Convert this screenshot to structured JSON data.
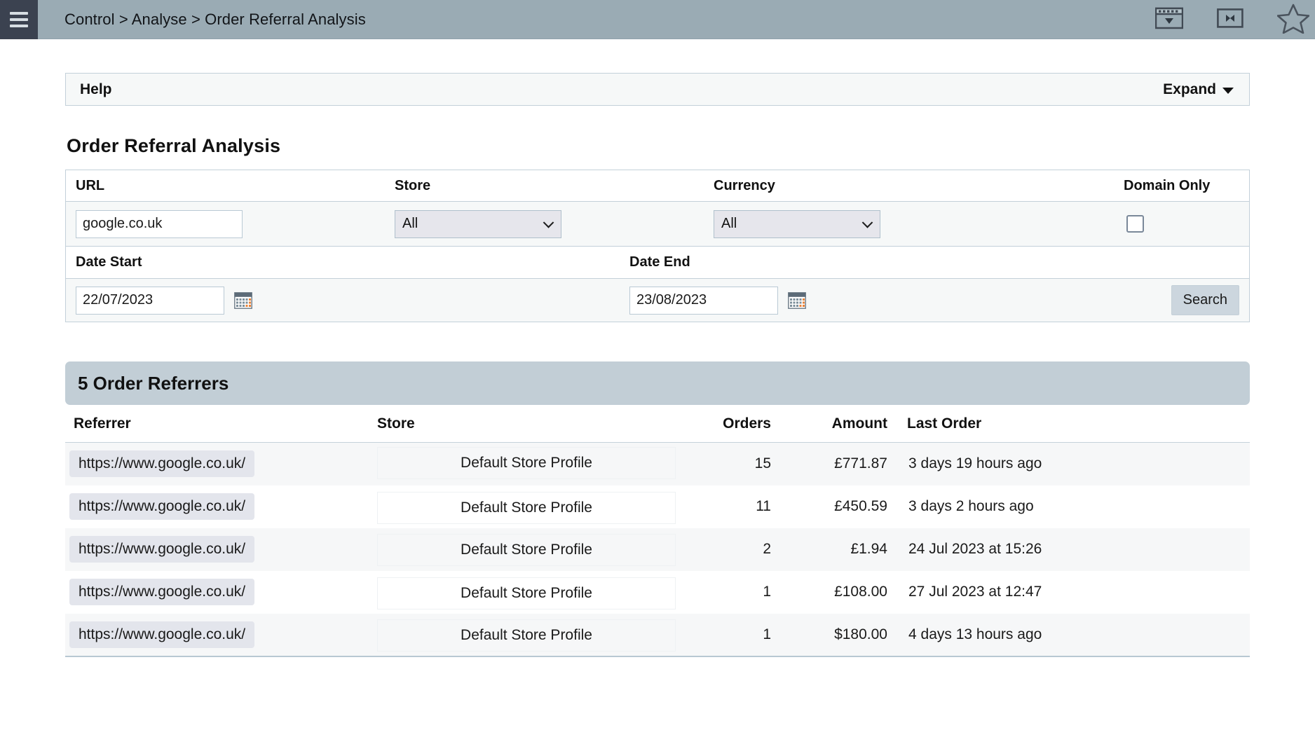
{
  "topbar": {
    "menu_icon": "hamburger-icon",
    "breadcrumb": "Control > Analyse > Order Referral Analysis",
    "icons": [
      {
        "name": "window-dropdown-icon"
      },
      {
        "name": "collapse-horizontal-icon"
      },
      {
        "name": "star-outline-icon"
      }
    ]
  },
  "help": {
    "title": "Help",
    "expand_label": "Expand"
  },
  "page": {
    "title": "Order Referral Analysis"
  },
  "filters": {
    "url": {
      "label": "URL",
      "value": "google.co.uk",
      "placeholder": ""
    },
    "store": {
      "label": "Store",
      "value": "All"
    },
    "currency": {
      "label": "Currency",
      "value": "All"
    },
    "domain_only": {
      "label": "Domain Only",
      "checked": false
    },
    "date_start": {
      "label": "Date Start",
      "value": "22/07/2023"
    },
    "date_end": {
      "label": "Date End",
      "value": "23/08/2023"
    },
    "search_label": "Search"
  },
  "results": {
    "title": "5 Order Referrers",
    "columns": {
      "referrer": "Referrer",
      "store": "Store",
      "orders": "Orders",
      "amount": "Amount",
      "last_order": "Last Order"
    },
    "rows": [
      {
        "referrer": "https://www.google.co.uk/",
        "store": "Default Store Profile",
        "orders": "15",
        "amount": "£771.87",
        "last_order": "3 days 19 hours ago"
      },
      {
        "referrer": "https://www.google.co.uk/",
        "store": "Default Store Profile",
        "orders": "11",
        "amount": "£450.59",
        "last_order": "3 days 2 hours ago"
      },
      {
        "referrer": "https://www.google.co.uk/",
        "store": "Default Store Profile",
        "orders": "2",
        "amount": "£1.94",
        "last_order": "24 Jul 2023 at 15:26"
      },
      {
        "referrer": "https://www.google.co.uk/",
        "store": "Default Store Profile",
        "orders": "1",
        "amount": "£108.00",
        "last_order": "27 Jul 2023 at 12:47"
      },
      {
        "referrer": "https://www.google.co.uk/",
        "store": "Default Store Profile",
        "orders": "1",
        "amount": "$180.00",
        "last_order": "4 days 13 hours ago"
      }
    ]
  },
  "colors": {
    "topbar_bg": "#9aabb4",
    "menu_bg": "#3b4250",
    "panel_border": "#c3d0d9",
    "panel_bg": "#f6f8f8",
    "results_header_bg": "#c2ced6",
    "pill_bg": "#e3e5ec",
    "select_bg": "#e6e6ec",
    "button_bg": "#ccd6de"
  }
}
